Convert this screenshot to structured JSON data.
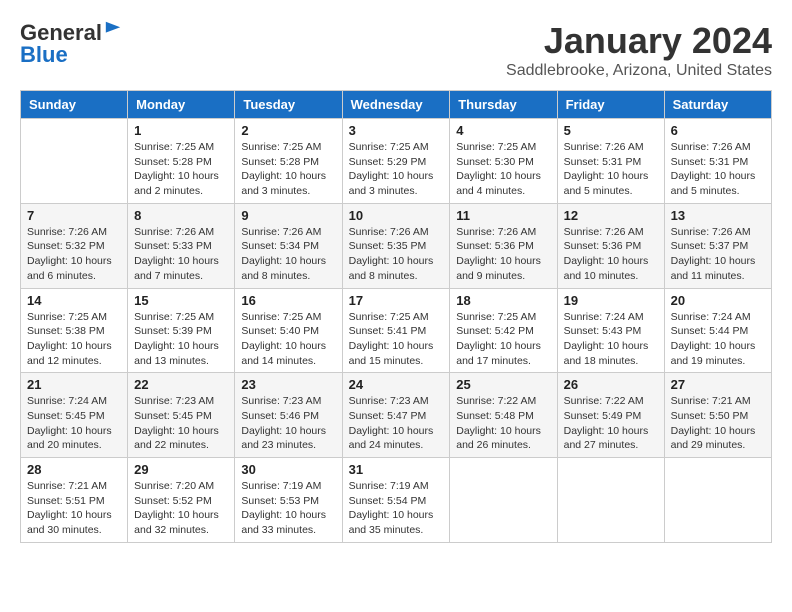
{
  "header": {
    "logo_general": "General",
    "logo_blue": "Blue",
    "month_year": "January 2024",
    "location": "Saddlebrooke, Arizona, United States"
  },
  "weekdays": [
    "Sunday",
    "Monday",
    "Tuesday",
    "Wednesday",
    "Thursday",
    "Friday",
    "Saturday"
  ],
  "weeks": [
    [
      {
        "day": "",
        "info": ""
      },
      {
        "day": "1",
        "info": "Sunrise: 7:25 AM\nSunset: 5:28 PM\nDaylight: 10 hours\nand 2 minutes."
      },
      {
        "day": "2",
        "info": "Sunrise: 7:25 AM\nSunset: 5:28 PM\nDaylight: 10 hours\nand 3 minutes."
      },
      {
        "day": "3",
        "info": "Sunrise: 7:25 AM\nSunset: 5:29 PM\nDaylight: 10 hours\nand 3 minutes."
      },
      {
        "day": "4",
        "info": "Sunrise: 7:25 AM\nSunset: 5:30 PM\nDaylight: 10 hours\nand 4 minutes."
      },
      {
        "day": "5",
        "info": "Sunrise: 7:26 AM\nSunset: 5:31 PM\nDaylight: 10 hours\nand 5 minutes."
      },
      {
        "day": "6",
        "info": "Sunrise: 7:26 AM\nSunset: 5:31 PM\nDaylight: 10 hours\nand 5 minutes."
      }
    ],
    [
      {
        "day": "7",
        "info": "Sunrise: 7:26 AM\nSunset: 5:32 PM\nDaylight: 10 hours\nand 6 minutes."
      },
      {
        "day": "8",
        "info": "Sunrise: 7:26 AM\nSunset: 5:33 PM\nDaylight: 10 hours\nand 7 minutes."
      },
      {
        "day": "9",
        "info": "Sunrise: 7:26 AM\nSunset: 5:34 PM\nDaylight: 10 hours\nand 8 minutes."
      },
      {
        "day": "10",
        "info": "Sunrise: 7:26 AM\nSunset: 5:35 PM\nDaylight: 10 hours\nand 8 minutes."
      },
      {
        "day": "11",
        "info": "Sunrise: 7:26 AM\nSunset: 5:36 PM\nDaylight: 10 hours\nand 9 minutes."
      },
      {
        "day": "12",
        "info": "Sunrise: 7:26 AM\nSunset: 5:36 PM\nDaylight: 10 hours\nand 10 minutes."
      },
      {
        "day": "13",
        "info": "Sunrise: 7:26 AM\nSunset: 5:37 PM\nDaylight: 10 hours\nand 11 minutes."
      }
    ],
    [
      {
        "day": "14",
        "info": "Sunrise: 7:25 AM\nSunset: 5:38 PM\nDaylight: 10 hours\nand 12 minutes."
      },
      {
        "day": "15",
        "info": "Sunrise: 7:25 AM\nSunset: 5:39 PM\nDaylight: 10 hours\nand 13 minutes."
      },
      {
        "day": "16",
        "info": "Sunrise: 7:25 AM\nSunset: 5:40 PM\nDaylight: 10 hours\nand 14 minutes."
      },
      {
        "day": "17",
        "info": "Sunrise: 7:25 AM\nSunset: 5:41 PM\nDaylight: 10 hours\nand 15 minutes."
      },
      {
        "day": "18",
        "info": "Sunrise: 7:25 AM\nSunset: 5:42 PM\nDaylight: 10 hours\nand 17 minutes."
      },
      {
        "day": "19",
        "info": "Sunrise: 7:24 AM\nSunset: 5:43 PM\nDaylight: 10 hours\nand 18 minutes."
      },
      {
        "day": "20",
        "info": "Sunrise: 7:24 AM\nSunset: 5:44 PM\nDaylight: 10 hours\nand 19 minutes."
      }
    ],
    [
      {
        "day": "21",
        "info": "Sunrise: 7:24 AM\nSunset: 5:45 PM\nDaylight: 10 hours\nand 20 minutes."
      },
      {
        "day": "22",
        "info": "Sunrise: 7:23 AM\nSunset: 5:45 PM\nDaylight: 10 hours\nand 22 minutes."
      },
      {
        "day": "23",
        "info": "Sunrise: 7:23 AM\nSunset: 5:46 PM\nDaylight: 10 hours\nand 23 minutes."
      },
      {
        "day": "24",
        "info": "Sunrise: 7:23 AM\nSunset: 5:47 PM\nDaylight: 10 hours\nand 24 minutes."
      },
      {
        "day": "25",
        "info": "Sunrise: 7:22 AM\nSunset: 5:48 PM\nDaylight: 10 hours\nand 26 minutes."
      },
      {
        "day": "26",
        "info": "Sunrise: 7:22 AM\nSunset: 5:49 PM\nDaylight: 10 hours\nand 27 minutes."
      },
      {
        "day": "27",
        "info": "Sunrise: 7:21 AM\nSunset: 5:50 PM\nDaylight: 10 hours\nand 29 minutes."
      }
    ],
    [
      {
        "day": "28",
        "info": "Sunrise: 7:21 AM\nSunset: 5:51 PM\nDaylight: 10 hours\nand 30 minutes."
      },
      {
        "day": "29",
        "info": "Sunrise: 7:20 AM\nSunset: 5:52 PM\nDaylight: 10 hours\nand 32 minutes."
      },
      {
        "day": "30",
        "info": "Sunrise: 7:19 AM\nSunset: 5:53 PM\nDaylight: 10 hours\nand 33 minutes."
      },
      {
        "day": "31",
        "info": "Sunrise: 7:19 AM\nSunset: 5:54 PM\nDaylight: 10 hours\nand 35 minutes."
      },
      {
        "day": "",
        "info": ""
      },
      {
        "day": "",
        "info": ""
      },
      {
        "day": "",
        "info": ""
      }
    ]
  ]
}
